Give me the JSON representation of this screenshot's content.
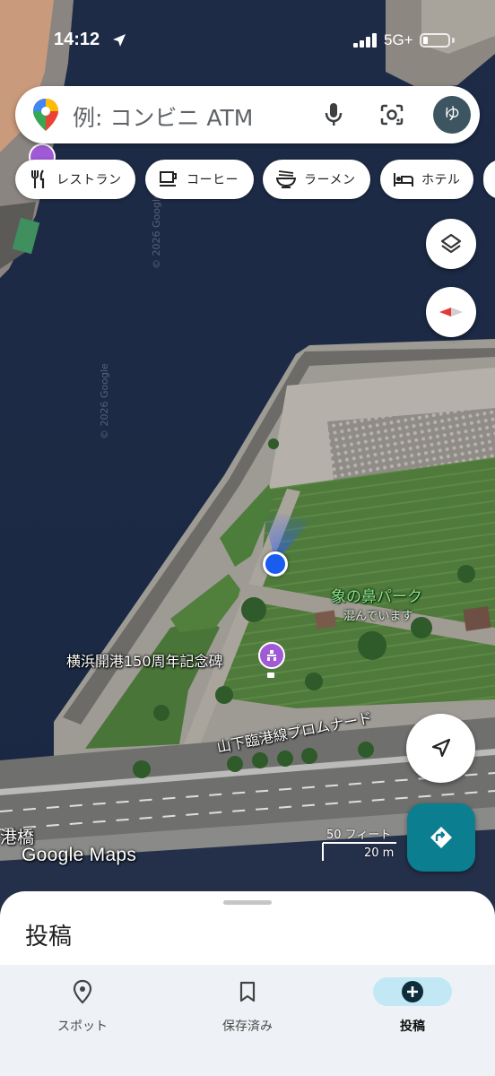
{
  "status_bar": {
    "time": "14:12",
    "network": "5G+"
  },
  "search": {
    "placeholder": "例: コンビニ ATM",
    "avatar_initial": "ゆ"
  },
  "chips": [
    {
      "label": "レストラン",
      "icon": "restaurant-icon"
    },
    {
      "label": "コーヒー",
      "icon": "coffee-icon"
    },
    {
      "label": "ラーメン",
      "icon": "ramen-icon"
    },
    {
      "label": "ホテル",
      "icon": "hotel-icon"
    }
  ],
  "map": {
    "places": {
      "park_name": "象の鼻パーク",
      "park_status": "混んでいます",
      "monument": "横浜開港150周年記念碑",
      "promenade": "山下臨港線プロムナード",
      "bridge_partial": "港橋"
    },
    "copyright": "© 2026 Google",
    "logo": "Google Maps",
    "scale": {
      "imperial": "50 フィート",
      "metric": "20 m"
    }
  },
  "sheet": {
    "title": "投稿"
  },
  "nav": [
    {
      "label": "スポット",
      "icon": "location-pin-icon",
      "active": false
    },
    {
      "label": "保存済み",
      "icon": "bookmark-icon",
      "active": false
    },
    {
      "label": "投稿",
      "icon": "add-circle-icon",
      "active": true
    }
  ],
  "colors": {
    "accent": "#0b7f8f",
    "active_tab_bg": "#c2e7f5",
    "user_location": "#1a73e8"
  }
}
